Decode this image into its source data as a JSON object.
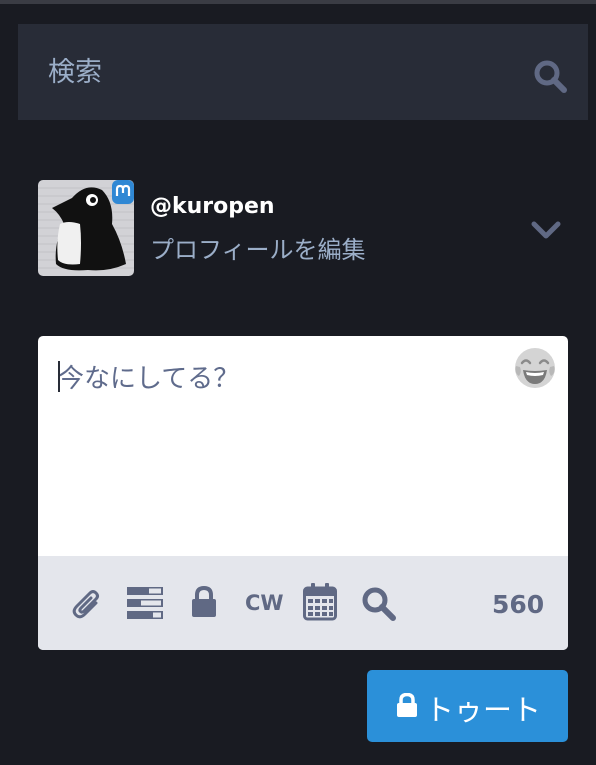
{
  "search": {
    "placeholder": "検索",
    "icon": "search-icon"
  },
  "account": {
    "username": "@kuropen",
    "edit_profile": "プロフィールを編集",
    "menu_icon": "chevron-down-icon",
    "badge_icon": "mastodon-logo-icon"
  },
  "compose": {
    "placeholder": "今なにしてる？",
    "emoji_icon": "tears-of-joy-emoji-icon",
    "toolbar": {
      "attach_icon": "paperclip-icon",
      "poll_icon": "poll-icon",
      "privacy_icon": "lock-icon",
      "cw_label": "CW",
      "schedule_icon": "calendar-icon",
      "search_icon": "search-icon"
    },
    "char_count": "560"
  },
  "toot": {
    "label": "トゥート",
    "icon": "lock-icon"
  },
  "colors": {
    "background": "#191b22",
    "panel": "#282c37",
    "accent": "#2b90d9",
    "muted_text": "#9baec8",
    "toolbar_bg": "#e4e6ec",
    "toolbar_icon": "#606984"
  }
}
